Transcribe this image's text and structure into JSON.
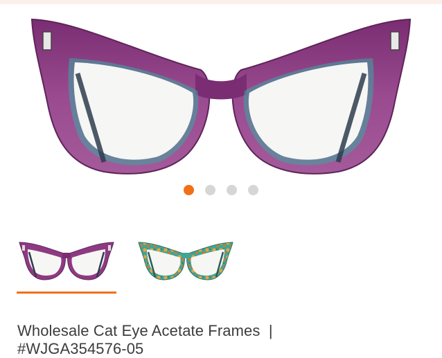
{
  "gallery": {
    "slide_count": 4,
    "active_slide": 1
  },
  "variants": [
    {
      "color_name": "purple",
      "selected": true
    },
    {
      "color_name": "green-floral",
      "selected": false
    }
  ],
  "product": {
    "title_line1": "Wholesale Cat Eye Acetate Frames  |",
    "title_line2": "#WJGA354576-05"
  },
  "colors": {
    "accent": "#f07018",
    "dot_inactive": "#d6d6d6",
    "frame_purple": "#8e3a82",
    "frame_inner_teal": "#3aa8a0"
  }
}
